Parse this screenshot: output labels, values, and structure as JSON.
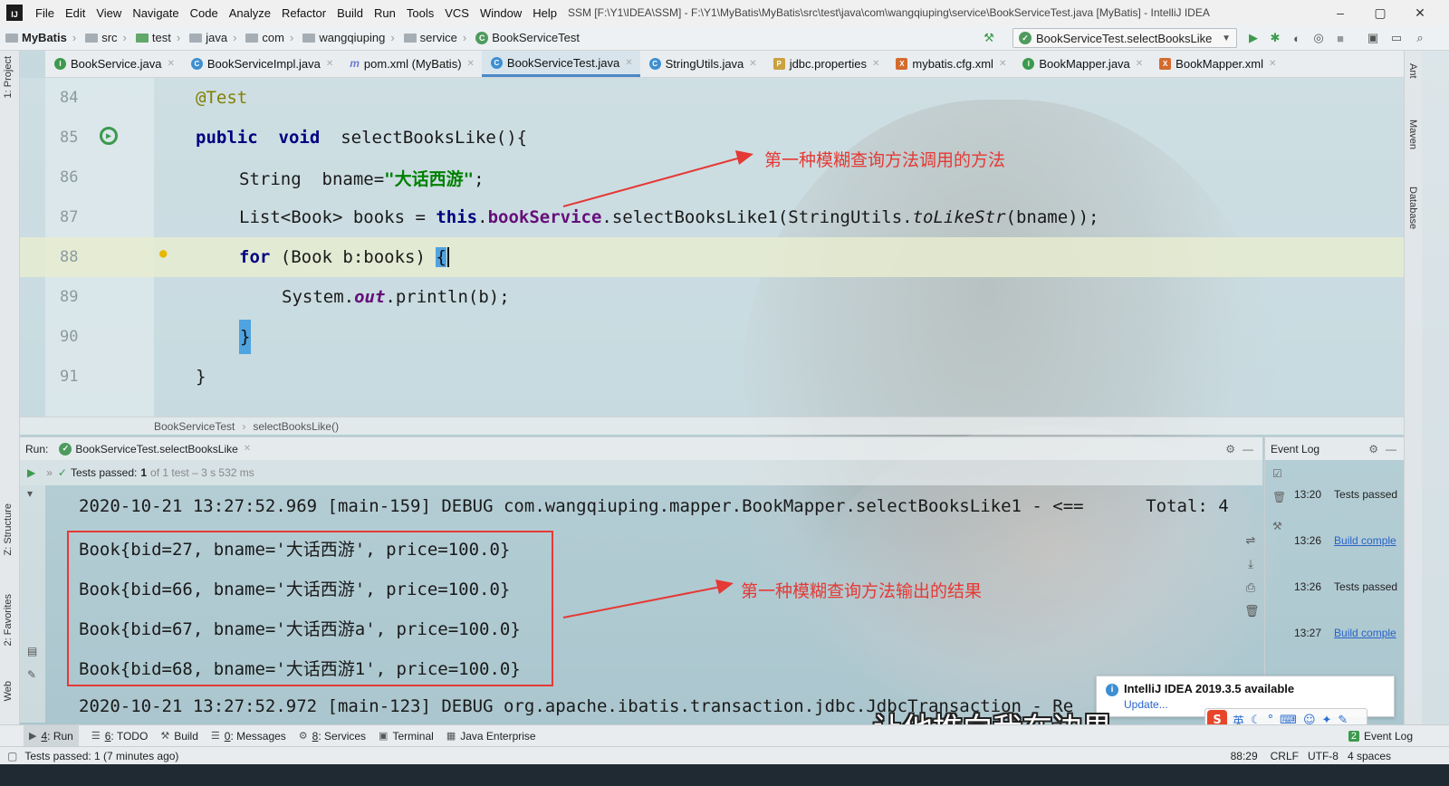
{
  "menubar": {
    "items": [
      "File",
      "Edit",
      "View",
      "Navigate",
      "Code",
      "Analyze",
      "Refactor",
      "Build",
      "Run",
      "Tools",
      "VCS",
      "Window",
      "Help"
    ],
    "window_title": "SSM [F:\\Y1\\IDEA\\SSM] - F:\\Y1\\MyBatis\\MyBatis\\src\\test\\java\\com\\wangqiuping\\service\\BookServiceTest.java [MyBatis] - IntelliJ IDEA",
    "logo": "IJ",
    "controls": [
      "–",
      "▢",
      "✕"
    ]
  },
  "navbar": {
    "project": "MyBatis",
    "crumbs": [
      "src",
      "test",
      "java",
      "com",
      "wangqiuping",
      "service",
      "BookServiceTest"
    ],
    "run_config": "BookServiceTest.selectBooksLike"
  },
  "tabs": [
    {
      "label": "BookService.java",
      "icon": "I"
    },
    {
      "label": "BookServiceImpl.java",
      "icon": "C"
    },
    {
      "label": "pom.xml (MyBatis)",
      "icon": "m"
    },
    {
      "label": "BookServiceTest.java",
      "icon": "C"
    },
    {
      "label": "StringUtils.java",
      "icon": "C"
    },
    {
      "label": "jdbc.properties",
      "icon": "P"
    },
    {
      "label": "mybatis.cfg.xml",
      "icon": "X"
    },
    {
      "label": "BookMapper.java",
      "icon": "I"
    },
    {
      "label": "BookMapper.xml",
      "icon": "X"
    }
  ],
  "side_tools": {
    "left": [
      "1: Project",
      "Z: Structure",
      "2: Favorites",
      "Web"
    ],
    "right": [
      "Ant",
      "Maven",
      "Database"
    ]
  },
  "editor": {
    "line_numbers": [
      "84",
      "85",
      "86",
      "87",
      "88",
      "89",
      "90",
      "91"
    ],
    "lines": {
      "l84": {
        "annotation": "@Test"
      },
      "l85": {
        "kw1": "public",
        "kw2": "void",
        "rest": "selectBooksLike(){"
      },
      "l86": {
        "type": "String",
        "name": "bname=",
        "str": "\"大话西游\"",
        "end": ";"
      },
      "l87": {
        "type": "List<Book> books = ",
        "kw": "this",
        "dot": ".",
        "field": "bookService",
        "call": ".selectBooksLike1(StringUtils.",
        "italic": "toLikeStr",
        "end": "(bname));"
      },
      "l88": {
        "kw": "for",
        "rest": " (Book b:books) ",
        "brace": "{"
      },
      "l89": {
        "pre": "System.",
        "field": "out",
        "end": ".println(b);"
      },
      "l90": {
        "brace": "}"
      },
      "l91": {
        "brace": "}"
      }
    },
    "breadcrumb": [
      "BookServiceTest",
      "selectBooksLike()"
    ]
  },
  "annotations": {
    "top": "第一种模糊查询方法调用的方法",
    "bottom": "第一种模糊查询方法输出的结果"
  },
  "run": {
    "label": "Run:",
    "config": "BookServiceTest.selectBooksLike",
    "status_prefix": "Tests passed:",
    "passed": "1",
    "status_suffix": "of 1 test – 3 s 532 ms",
    "console": [
      "2020-10-21 13:27:52.969 [main-159] DEBUG com.wangqiuping.mapper.BookMapper.selectBooksLike1 - <==      Total: 4",
      "Book{bid=27, bname='大话西游', price=100.0}",
      "Book{bid=66, bname='大话西游', price=100.0}",
      "Book{bid=67, bname='大话西游a', price=100.0}",
      "Book{bid=68, bname='大话西游1', price=100.0}",
      "2020-10-21 13:27:52.972 [main-123] DEBUG org.apache.ibatis.transaction.jdbc.JdbcTransaction - Re"
    ]
  },
  "event_log": {
    "title": "Event Log",
    "entries": [
      {
        "time": "13:20",
        "text": "Tests passed",
        "link": false
      },
      {
        "time": "13:26",
        "text": "Build comple",
        "link": true
      },
      {
        "time": "13:26",
        "text": "Tests passed",
        "link": false
      },
      {
        "time": "13:27",
        "text": "Build comple",
        "link": true
      }
    ]
  },
  "notification": {
    "title": "IntelliJ IDEA 2019.3.5 available",
    "link": "Update..."
  },
  "subtitle": "让他推向我在边界",
  "ime": {
    "logo": "S",
    "lang": "英"
  },
  "bottom_tools": [
    {
      "num": "4",
      "label": ": Run"
    },
    {
      "num": "6",
      "label": ": TODO"
    },
    {
      "num": "",
      "label": "Build"
    },
    {
      "num": "0",
      "label": ": Messages"
    },
    {
      "num": "8",
      "label": ": Services"
    },
    {
      "num": "",
      "label": "Terminal"
    },
    {
      "num": "",
      "label": "Java Enterprise"
    }
  ],
  "event_log_button": {
    "badge": "2",
    "label": "Event Log"
  },
  "status": {
    "message": "Tests passed: 1 (7 minutes ago)",
    "position": "88:29",
    "line_sep": "CRLF",
    "encoding": "UTF-8",
    "indent": "4 spaces"
  }
}
